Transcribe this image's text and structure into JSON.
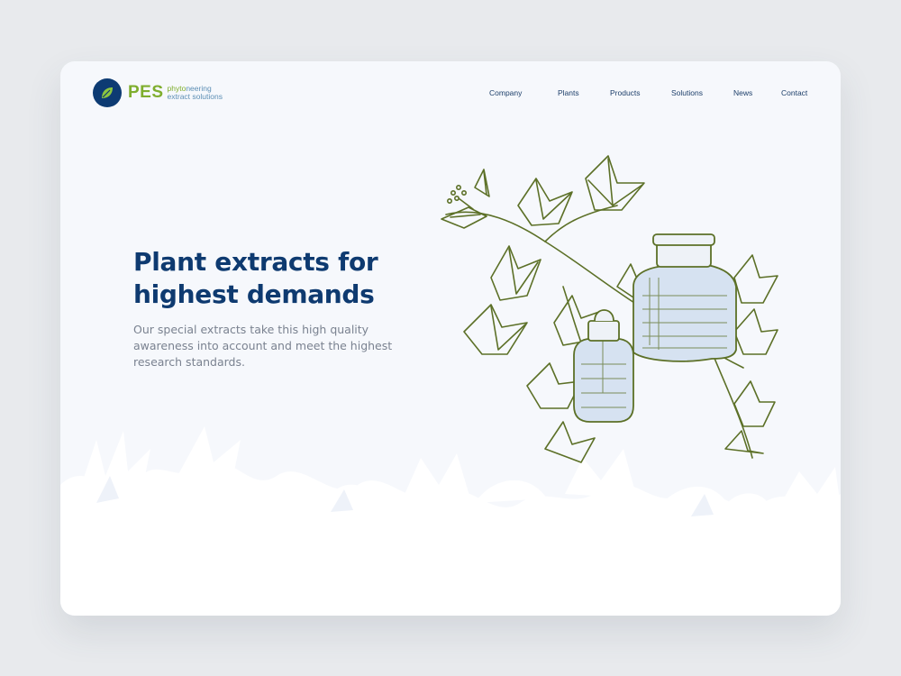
{
  "brand": {
    "name": "PES",
    "tagline_accent": "phyto",
    "tagline_rest": "neering",
    "tagline_line2": "extract solutions"
  },
  "nav": [
    {
      "label": "Company"
    },
    {
      "label": "Plants"
    },
    {
      "label": "Products"
    },
    {
      "label": "Solutions"
    },
    {
      "label": "News"
    },
    {
      "label": "Contact"
    }
  ],
  "hero": {
    "headline_line1": "Plant extracts for",
    "headline_line2": "highest demands",
    "subtext": "Our special extracts take this high quality awareness into account and meet the highest research standards."
  },
  "colors": {
    "page_background": "#e8eaed",
    "card_background": "#f6f8fc",
    "brand_navy": "#0d3b73",
    "brand_green": "#7fae2e",
    "illustration_green": "#5c7027",
    "bottle_fill": "#d6e2f1"
  },
  "icons": {
    "logo": "leaf-icon",
    "illustration": "ivy-and-bottles-illustration"
  }
}
